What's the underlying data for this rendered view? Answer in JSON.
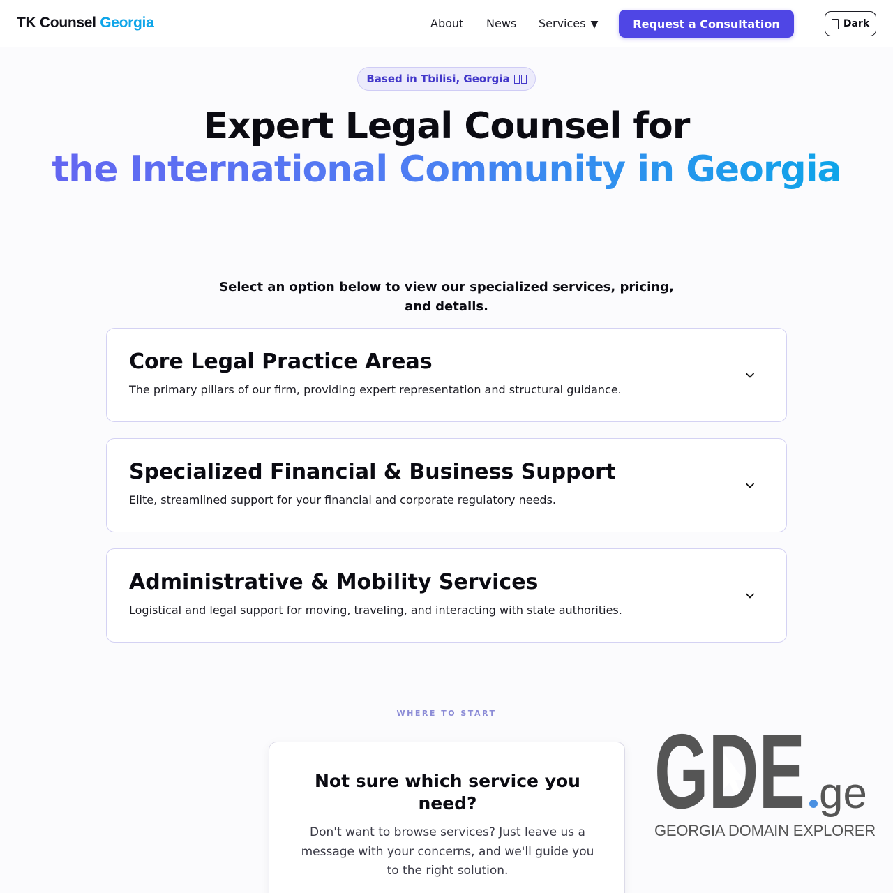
{
  "header": {
    "brand_part1": "TK Counsel",
    "brand_part2": "Georgia",
    "nav": {
      "about": "About",
      "news": "News",
      "services": "Services",
      "services_caret": "▼"
    },
    "cta_label": "Request a Consultation",
    "theme_toggle_label": "Dark",
    "theme_toggle_icon": "moon-icon"
  },
  "hero": {
    "badge": "Based in Tbilisi, Georgia",
    "badge_icon": "georgia-flag-icon",
    "title_line1": "Expert Legal Counsel for",
    "title_line2": "the International Community in Georgia",
    "intro": "Select an option below to view our specialized services, pricing, and details."
  },
  "services": [
    {
      "title": "Core Legal Practice Areas",
      "description": "The primary pillars of our firm, providing expert representation and structural guidance."
    },
    {
      "title": "Specialized Financial & Business Support",
      "description": "Elite, streamlined support for your financial and corporate regulatory needs."
    },
    {
      "title": "Administrative & Mobility Services",
      "description": "Logistical and legal support for moving, traveling, and interacting with state authorities."
    }
  ],
  "where_to_start": {
    "eyebrow": "WHERE TO START",
    "title": "Not sure which service you need?",
    "body": "Don't want to browse services? Just leave us a message with your concerns, and we'll guide you to the right solution."
  },
  "partner_logo": {
    "wordmark": "GDE",
    "tld": ".ge",
    "caption": "GEORGIA DOMAIN EXPLORER"
  },
  "colors": {
    "accent": "#4f46e5",
    "brand_blue": "#0ea5e9",
    "gradient_start": "#6366f1",
    "gradient_end": "#0ea5e9",
    "card_border": "#d4d2f3",
    "logo_gray": "#555555",
    "logo_dot": "#4a90e2"
  }
}
